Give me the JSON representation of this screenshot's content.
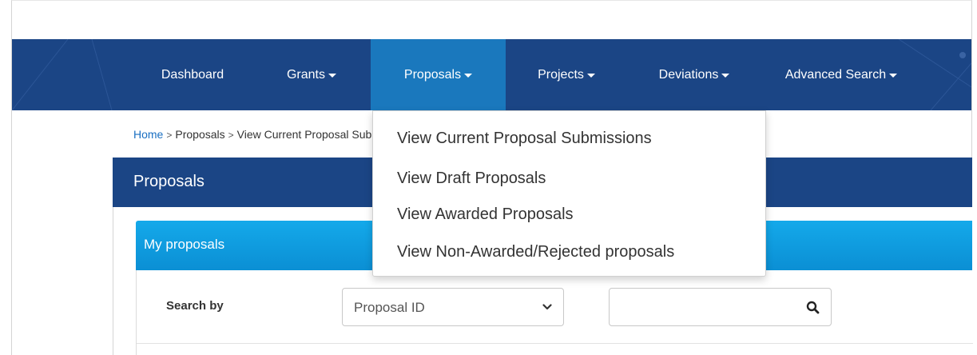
{
  "colors": {
    "navbar_bg": "#1b4585",
    "nav_active_bg": "#1a78bd",
    "subpanel_bg": "#0b8fd4",
    "link": "#1a6fc2"
  },
  "nav": {
    "items": [
      {
        "label": "Dashboard",
        "caret": false
      },
      {
        "label": "Grants",
        "caret": true
      },
      {
        "label": "Proposals",
        "caret": true,
        "active": true
      },
      {
        "label": "Projects",
        "caret": true
      },
      {
        "label": "Deviations",
        "caret": true
      },
      {
        "label": "Advanced Search",
        "caret": true
      }
    ]
  },
  "breadcrumb": {
    "home": "Home",
    "separator": ">",
    "section": "Proposals",
    "current": "View Current Proposal Submissions"
  },
  "panel": {
    "title": "Proposals"
  },
  "subpanel": {
    "title": "My proposals"
  },
  "search": {
    "label": "Search by",
    "select_value": "Proposal ID",
    "input_value": "",
    "icons": {
      "select": "chevron-down-icon",
      "search": "search-icon"
    }
  },
  "dropdown": {
    "items": [
      "View Current Proposal Submissions",
      "View Draft Proposals",
      "View Awarded Proposals",
      "View Non-Awarded/Rejected proposals"
    ]
  }
}
